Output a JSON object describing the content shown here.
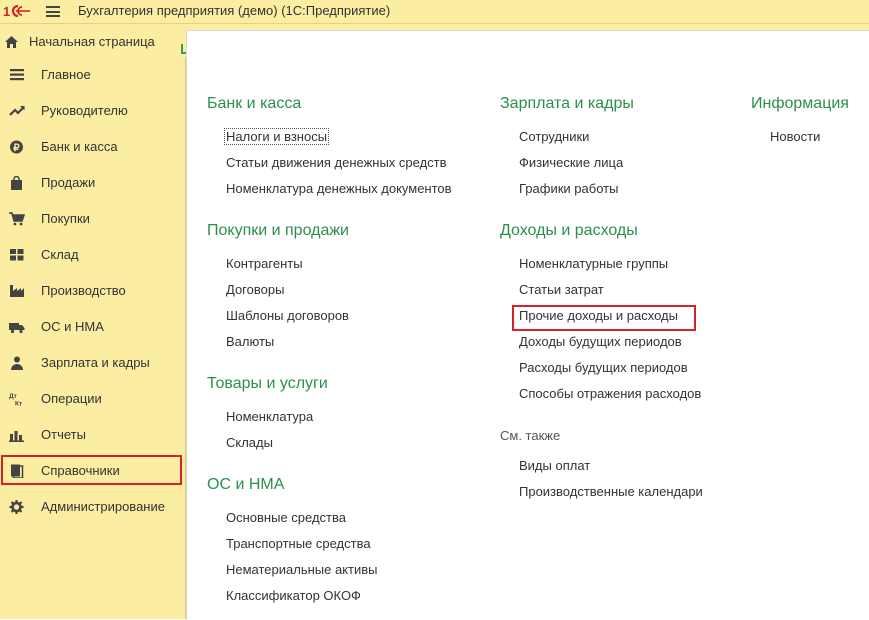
{
  "titlebar": {
    "title": "Бухгалтерия предприятия (демо)  (1С:Предприятие)"
  },
  "tabs": {
    "start_page": "Начальная страница"
  },
  "sidebar": {
    "items": [
      {
        "label": "Главное",
        "icon": "menu-lines-icon"
      },
      {
        "label": "Руководителю",
        "icon": "trend-up-icon"
      },
      {
        "label": "Банк и касса",
        "icon": "ruble-icon"
      },
      {
        "label": "Продажи",
        "icon": "shopping-bag-icon"
      },
      {
        "label": "Покупки",
        "icon": "cart-icon"
      },
      {
        "label": "Склад",
        "icon": "warehouse-grid-icon"
      },
      {
        "label": "Производство",
        "icon": "factory-icon"
      },
      {
        "label": "ОС и НМА",
        "icon": "truck-icon"
      },
      {
        "label": "Зарплата и кадры",
        "icon": "person-icon"
      },
      {
        "label": "Операции",
        "icon": "dt-kt-icon"
      },
      {
        "label": "Отчеты",
        "icon": "bar-chart-icon"
      },
      {
        "label": "Справочники",
        "icon": "books-icon"
      },
      {
        "label": "Администрирование",
        "icon": "gear-icon"
      }
    ]
  },
  "main": {
    "col1": {
      "bank": {
        "title": "Банк и касса",
        "links": [
          "Налоги и взносы",
          "Статьи движения денежных средств",
          "Номенклатура денежных документов"
        ]
      },
      "purchases": {
        "title": "Покупки и продажи",
        "links": [
          "Контрагенты",
          "Договоры",
          "Шаблоны договоров",
          "Валюты"
        ]
      },
      "goods": {
        "title": "Товары и услуги",
        "links": [
          "Номенклатура",
          "Склады"
        ]
      },
      "assets": {
        "title": "ОС и НМА",
        "links": [
          "Основные средства",
          "Транспортные средства",
          "Нематериальные активы",
          "Классификатор ОКОФ"
        ]
      }
    },
    "col2": {
      "salary": {
        "title": "Зарплата и кадры",
        "links": [
          "Сотрудники",
          "Физические лица",
          "Графики работы"
        ]
      },
      "income": {
        "title": "Доходы и расходы",
        "links": [
          "Номенклатурные группы",
          "Статьи затрат",
          "Прочие доходы и расходы",
          "Доходы будущих периодов",
          "Расходы будущих периодов",
          "Способы отражения расходов"
        ]
      },
      "seealso": {
        "title": "См. также",
        "links": [
          "Виды оплат",
          "Производственные календари"
        ]
      }
    },
    "col3": {
      "info": {
        "title": "Информация",
        "links": [
          "Новости"
        ]
      }
    }
  },
  "colors": {
    "sidebar_bg": "#fbeda1",
    "section_title": "#2d8f4e",
    "highlight_box": "#d4242b"
  }
}
